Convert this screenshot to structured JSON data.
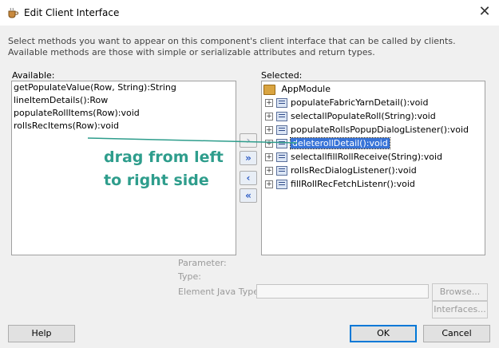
{
  "window": {
    "title": "Edit Client Interface",
    "close_symbol": "✕"
  },
  "instructions": "Select methods you want to appear on this component's client interface that can be called by clients.  Available methods are those with simple or serializable attributes and return types.",
  "available": {
    "label": "Available:",
    "items": [
      "getPopulateValue(Row, String):String",
      "lineItemDetails():Row",
      "populateRollItems(Row):void",
      "rollsRecItems(Row):void"
    ]
  },
  "selected": {
    "label": "Selected:",
    "root": "AppModule",
    "items": [
      "populateFabricYarnDetail():void",
      "selectallPopulateRoll(String):void",
      "populateRollsPopupDialogListener():void",
      "deleterollDetail():void",
      "selectallfillRollReceive(String):void",
      "rollsRecDialogListener():void",
      "fillRollRecFetchListenr():void"
    ],
    "selected_index": 3
  },
  "shuttle": {
    "add": "›",
    "add_all": "»",
    "remove": "‹",
    "remove_all": "«"
  },
  "annotation": {
    "line1": "drag from left",
    "line2": "to right side",
    "color": "#2e9d8c"
  },
  "details": {
    "parameter_label": "Parameter:",
    "type_label": "Type:",
    "element_java_type_label": "Element Java Type:",
    "browse_button": "Browse...",
    "interfaces_button": "Interfaces..."
  },
  "buttons": {
    "help": "Help",
    "ok": "OK",
    "cancel": "Cancel"
  },
  "icons": {
    "title": "coffee-cup-icon",
    "root": "folder-icon",
    "method": "method-icon",
    "expander": "expand-plus-icon"
  }
}
